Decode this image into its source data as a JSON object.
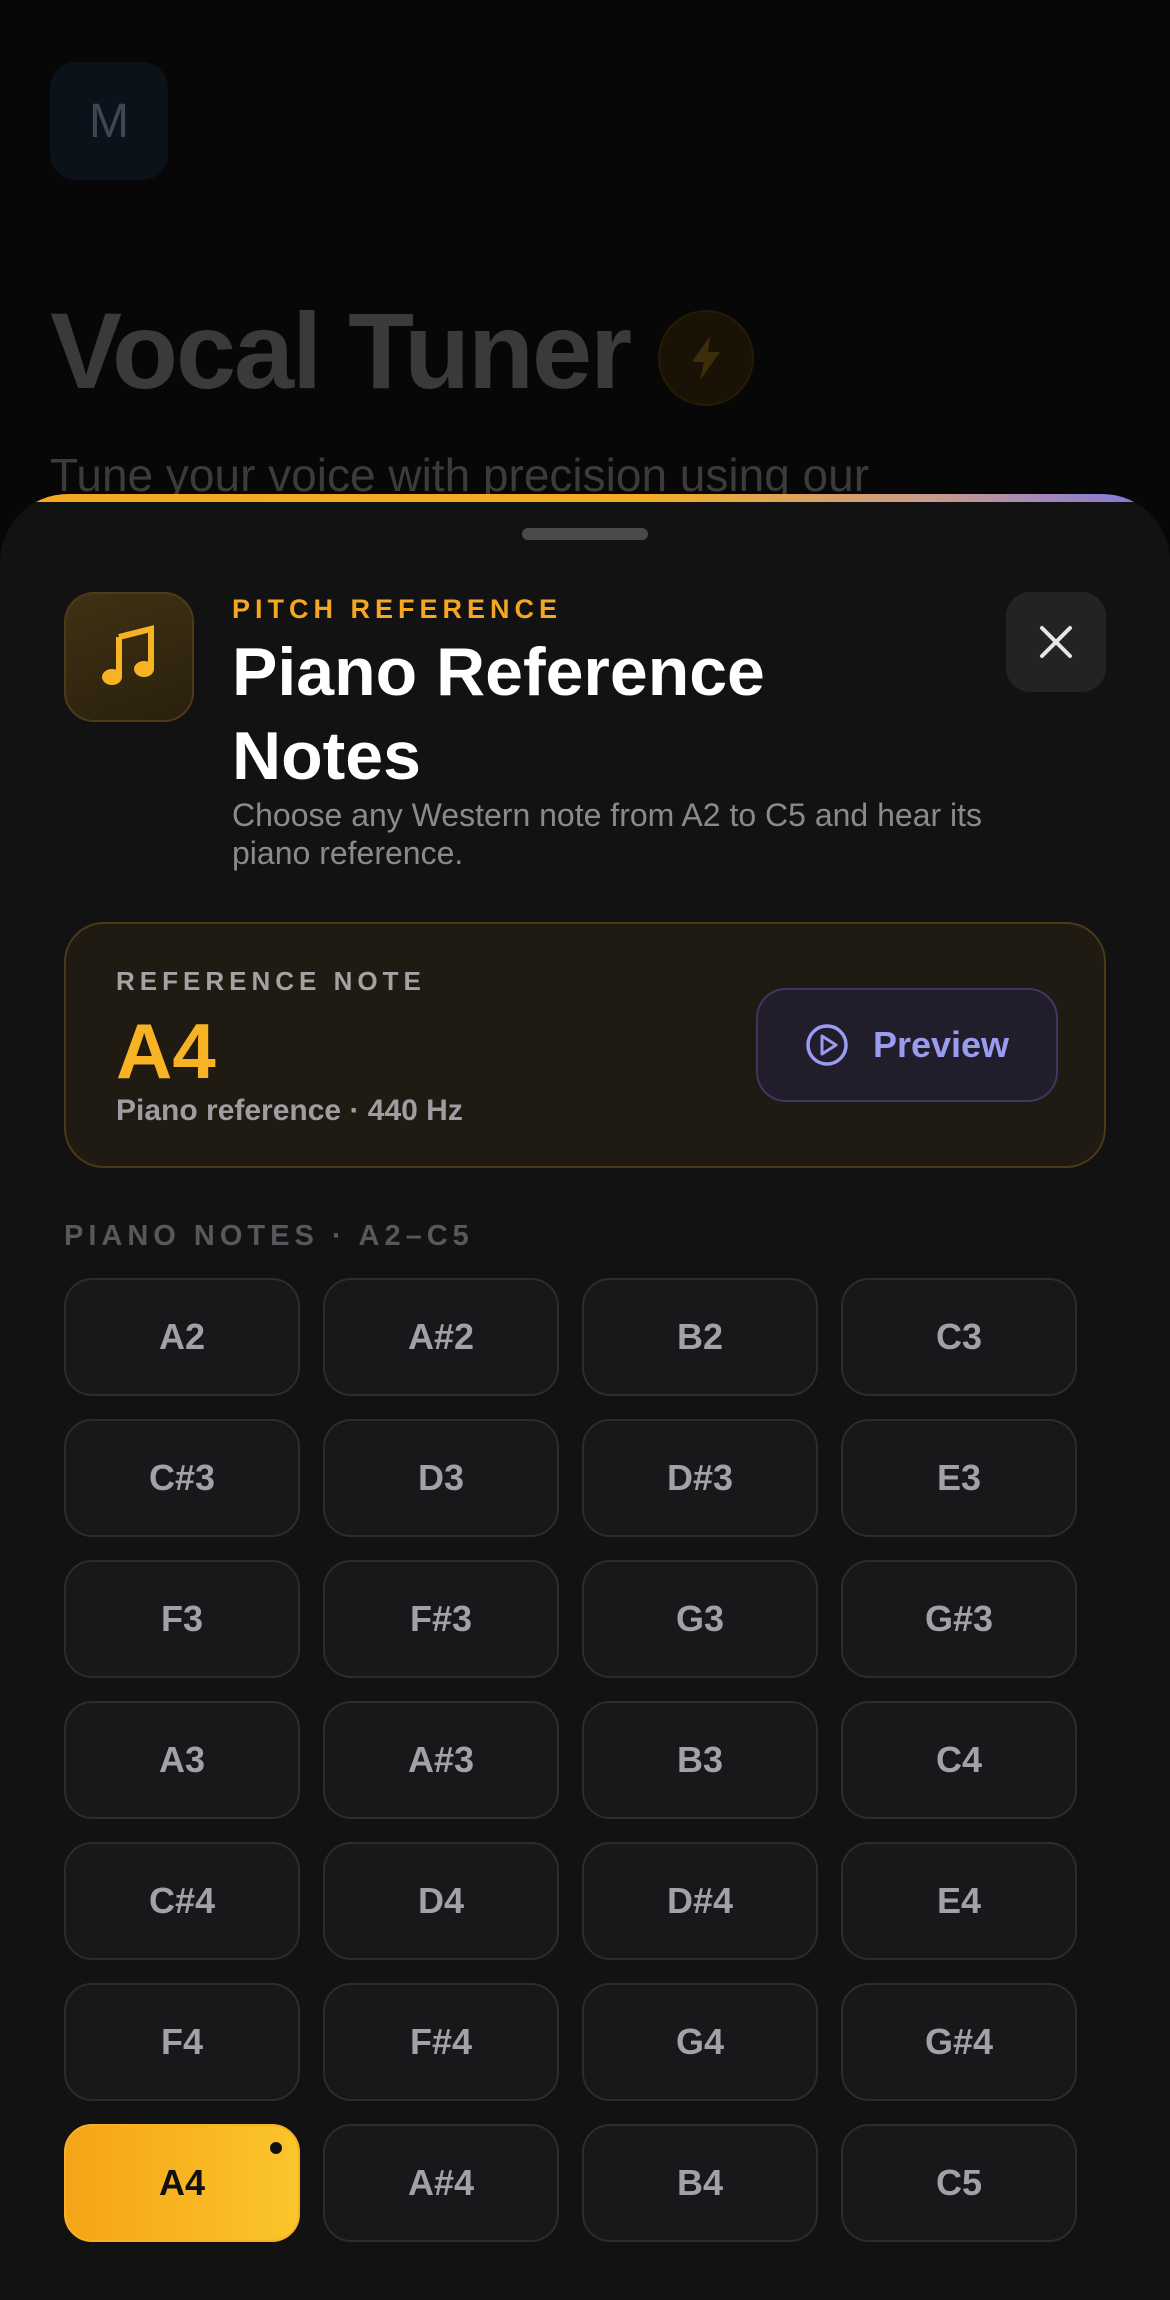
{
  "background": {
    "avatar_letter": "M",
    "title": "Vocal Tuner",
    "subtitle": "Tune your voice with precision using our"
  },
  "sheet": {
    "kicker": "PITCH REFERENCE",
    "title": "Piano Reference Notes",
    "subtitle": "Choose any Western note from A2 to C5 and hear its piano reference.",
    "header_icon": "music-note-icon",
    "close_icon": "close-icon"
  },
  "reference": {
    "label": "REFERENCE NOTE",
    "note": "A4",
    "description": "Piano reference · 440 Hz",
    "preview_label": "Preview",
    "preview_icon": "play-circle-icon"
  },
  "notes_section": {
    "label": "PIANO NOTES · A2–C5",
    "selected": "A4",
    "notes": [
      "A2",
      "A#2",
      "B2",
      "C3",
      "C#3",
      "D3",
      "D#3",
      "E3",
      "F3",
      "F#3",
      "G3",
      "G#3",
      "A3",
      "A#3",
      "B3",
      "C4",
      "C#4",
      "D4",
      "D#4",
      "E4",
      "F4",
      "F#4",
      "G4",
      "G#4",
      "A4",
      "A#4",
      "B4",
      "C5"
    ]
  },
  "colors": {
    "accent_amber": "#f5a623",
    "accent_violet": "#9a9cf2",
    "sheet_bg": "#121213"
  }
}
